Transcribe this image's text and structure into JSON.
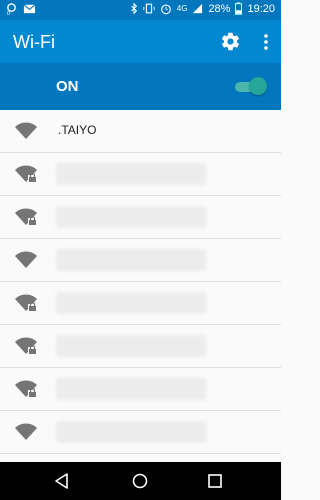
{
  "status_bar": {
    "left_icons": [
      "data-saver-icon",
      "mail-icon"
    ],
    "right_icons": [
      "bluetooth-icon",
      "vibrate-icon",
      "alarm-icon",
      "lte-signal-icon",
      "battery-icon"
    ],
    "network": "4G",
    "battery": "28%",
    "time": "19:20"
  },
  "app_bar": {
    "title": "Wi-Fi",
    "settings_icon": "gear-icon",
    "menu_icon": "more-vert-icon"
  },
  "master_switch": {
    "label": "ON",
    "on": true,
    "accent": "#26a69a"
  },
  "networks": [
    {
      "ssid": ".TAIYO",
      "secured": false
    },
    {
      "ssid": "",
      "secured": true
    },
    {
      "ssid": "",
      "secured": true
    },
    {
      "ssid": "",
      "secured": false
    },
    {
      "ssid": "",
      "secured": true
    },
    {
      "ssid": "",
      "secured": true
    },
    {
      "ssid": "",
      "secured": true
    },
    {
      "ssid": "",
      "secured": false
    }
  ],
  "nav_bar": [
    "back-icon",
    "home-icon",
    "recents-icon"
  ],
  "colors": {
    "status_bar": "#0277bd",
    "app_bar": "#0288d1",
    "switch_bar": "#0277bd"
  }
}
